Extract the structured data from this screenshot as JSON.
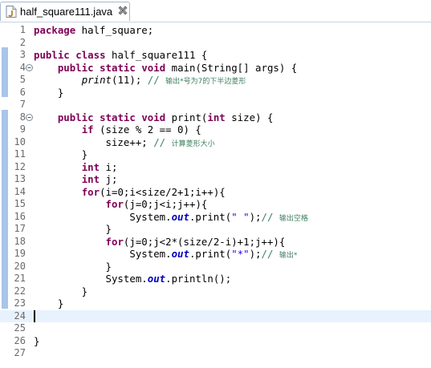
{
  "tab": {
    "title": "half_square111.java",
    "icon": "java-file-icon",
    "close_icon": "close-icon"
  },
  "editor": {
    "current_line": 24,
    "lines": [
      {
        "n": "1",
        "fold": false,
        "segs": [
          {
            "t": "package",
            "c": "kw"
          },
          {
            "t": " half_square;"
          }
        ]
      },
      {
        "n": "2",
        "fold": false,
        "segs": []
      },
      {
        "n": "3",
        "fold": false,
        "segs": [
          {
            "t": "public",
            "c": "kw"
          },
          {
            "t": " "
          },
          {
            "t": "class",
            "c": "kw"
          },
          {
            "t": " half_square111 {"
          }
        ]
      },
      {
        "n": "4",
        "fold": true,
        "segs": [
          {
            "t": "    "
          },
          {
            "t": "public",
            "c": "kw"
          },
          {
            "t": " "
          },
          {
            "t": "static",
            "c": "kw"
          },
          {
            "t": " "
          },
          {
            "t": "void",
            "c": "kw"
          },
          {
            "t": " main(String[] args) {"
          }
        ]
      },
      {
        "n": "5",
        "fold": false,
        "segs": [
          {
            "t": "        "
          },
          {
            "t": "print",
            "c": "it"
          },
          {
            "t": "(11); "
          },
          {
            "t": "// ",
            "c": "cm"
          },
          {
            "t": "输出*号为7的下半边菱形",
            "c": "cm cm-cjk"
          }
        ]
      },
      {
        "n": "6",
        "fold": false,
        "segs": [
          {
            "t": "    }"
          }
        ]
      },
      {
        "n": "7",
        "fold": false,
        "segs": []
      },
      {
        "n": "8",
        "fold": true,
        "segs": [
          {
            "t": "    "
          },
          {
            "t": "public",
            "c": "kw"
          },
          {
            "t": " "
          },
          {
            "t": "static",
            "c": "kw"
          },
          {
            "t": " "
          },
          {
            "t": "void",
            "c": "kw"
          },
          {
            "t": " print("
          },
          {
            "t": "int",
            "c": "kw"
          },
          {
            "t": " size) {"
          }
        ]
      },
      {
        "n": "9",
        "fold": false,
        "segs": [
          {
            "t": "        "
          },
          {
            "t": "if",
            "c": "kw"
          },
          {
            "t": " (size % 2 == 0) {"
          }
        ]
      },
      {
        "n": "10",
        "fold": false,
        "segs": [
          {
            "t": "            size++; "
          },
          {
            "t": "// ",
            "c": "cm"
          },
          {
            "t": "计算菱形大小",
            "c": "cm cm-cjk"
          }
        ]
      },
      {
        "n": "11",
        "fold": false,
        "segs": [
          {
            "t": "        }"
          }
        ]
      },
      {
        "n": "12",
        "fold": false,
        "segs": [
          {
            "t": "        "
          },
          {
            "t": "int",
            "c": "kw"
          },
          {
            "t": " i;"
          }
        ]
      },
      {
        "n": "13",
        "fold": false,
        "segs": [
          {
            "t": "        "
          },
          {
            "t": "int",
            "c": "kw"
          },
          {
            "t": " j;"
          }
        ]
      },
      {
        "n": "14",
        "fold": false,
        "segs": [
          {
            "t": "        "
          },
          {
            "t": "for",
            "c": "kw"
          },
          {
            "t": "(i=0;i<size/2+1;i++){"
          }
        ]
      },
      {
        "n": "15",
        "fold": false,
        "segs": [
          {
            "t": "            "
          },
          {
            "t": "for",
            "c": "kw"
          },
          {
            "t": "(j=0;j<i;j++){"
          }
        ]
      },
      {
        "n": "16",
        "fold": false,
        "segs": [
          {
            "t": "                System."
          },
          {
            "t": "out",
            "c": "fld"
          },
          {
            "t": ".print("
          },
          {
            "t": "\" \"",
            "c": "str"
          },
          {
            "t": ");"
          },
          {
            "t": "// ",
            "c": "cm"
          },
          {
            "t": "输出空格",
            "c": "cm cm-cjk"
          }
        ]
      },
      {
        "n": "17",
        "fold": false,
        "segs": [
          {
            "t": "            }"
          }
        ]
      },
      {
        "n": "18",
        "fold": false,
        "segs": [
          {
            "t": "            "
          },
          {
            "t": "for",
            "c": "kw"
          },
          {
            "t": "(j=0;j<2*(size/2-i)+1;j++){"
          }
        ]
      },
      {
        "n": "19",
        "fold": false,
        "segs": [
          {
            "t": "                System."
          },
          {
            "t": "out",
            "c": "fld"
          },
          {
            "t": ".print("
          },
          {
            "t": "\"*\"",
            "c": "str"
          },
          {
            "t": ");"
          },
          {
            "t": "// ",
            "c": "cm"
          },
          {
            "t": "输出*",
            "c": "cm cm-cjk"
          }
        ]
      },
      {
        "n": "20",
        "fold": false,
        "segs": [
          {
            "t": "            }"
          }
        ]
      },
      {
        "n": "21",
        "fold": false,
        "segs": [
          {
            "t": "            System."
          },
          {
            "t": "out",
            "c": "fld"
          },
          {
            "t": ".println();"
          }
        ]
      },
      {
        "n": "22",
        "fold": false,
        "segs": [
          {
            "t": "        }"
          }
        ]
      },
      {
        "n": "23",
        "fold": false,
        "segs": [
          {
            "t": "    }"
          }
        ]
      },
      {
        "n": "24",
        "fold": false,
        "segs": []
      },
      {
        "n": "25",
        "fold": false,
        "segs": []
      },
      {
        "n": "26",
        "fold": false,
        "segs": [
          {
            "t": "}"
          }
        ]
      },
      {
        "n": "27",
        "fold": false,
        "segs": []
      }
    ]
  },
  "colors": {
    "keyword": "#7f0055",
    "comment": "#3f7f5f",
    "string": "#2a00ff",
    "field": "#0000c0",
    "current_line": "#e8f2fe",
    "fold_band": "#a9c5e8"
  }
}
